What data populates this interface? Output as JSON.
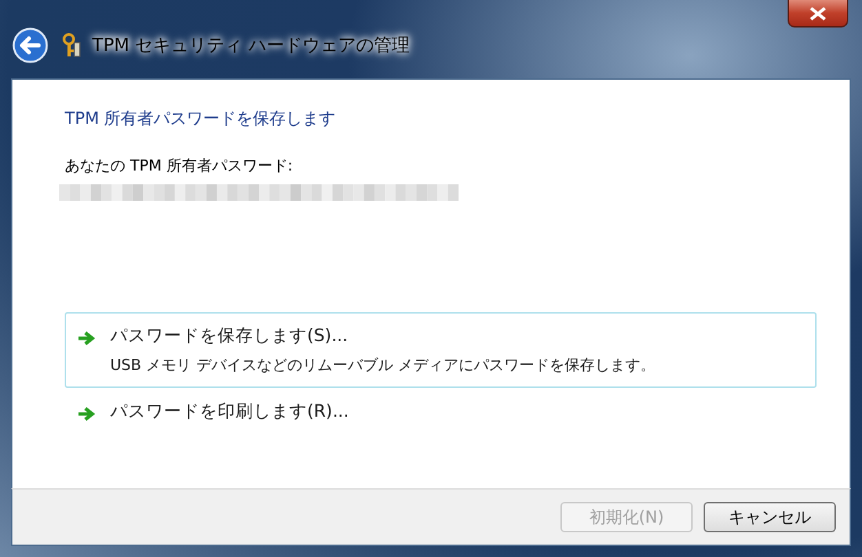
{
  "window": {
    "title": "TPM セキュリティ ハードウェアの管理"
  },
  "heading": "TPM 所有者パスワードを保存します",
  "password_label": "あなたの TPM 所有者パスワード:",
  "commands": [
    {
      "label": "パスワードを保存します(S)...",
      "description": "USB メモリ デバイスなどのリムーバブル メディアにパスワードを保存します。",
      "selected": true
    },
    {
      "label": "パスワードを印刷します(R)...",
      "selected": false
    }
  ],
  "buttons": [
    {
      "label": "初期化(N)",
      "disabled": true
    },
    {
      "label": "キャンセル",
      "disabled": false
    }
  ]
}
